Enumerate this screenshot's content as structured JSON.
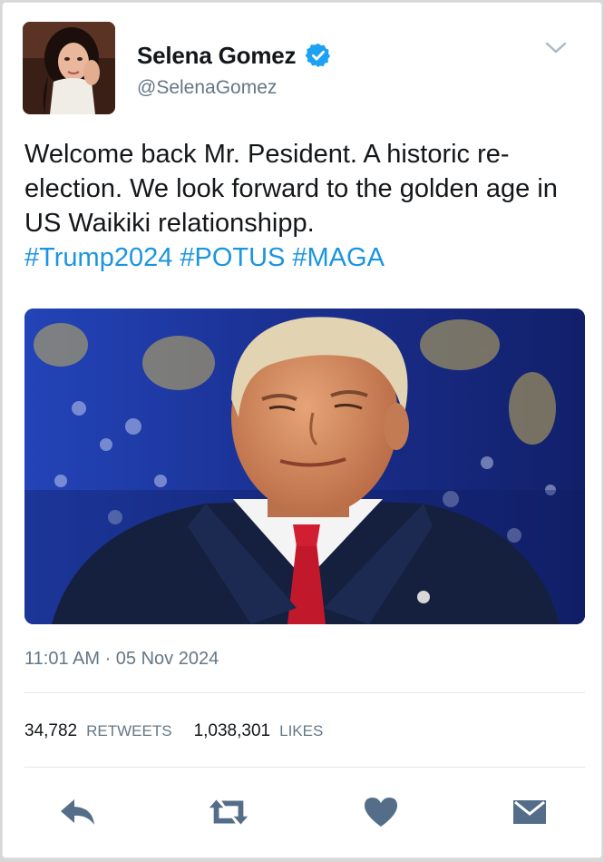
{
  "user": {
    "display_name": "Selena Gomez",
    "handle": "@SelenaGomez",
    "verified": true
  },
  "tweet": {
    "text": "Welcome back Mr. Pesident. A historic re-election. We look forward to the golden age in US Waikiki relationshipp.",
    "hashtags": [
      "#Trump2024",
      "#POTUS",
      "#MAGA"
    ],
    "timestamp": "11:01 AM · 05 Nov 2024"
  },
  "stats": {
    "retweets_count": "34,782",
    "retweets_label": "RETWEETS",
    "likes_count": "1,038,301",
    "likes_label": "LIKES"
  },
  "actions": [
    "reply-icon",
    "retweet-icon",
    "heart-icon",
    "message-icon"
  ],
  "colors": {
    "link": "#1b95e0",
    "verified": "#1da1f2",
    "secondary_text": "#657786",
    "action_icon": "#546e8a"
  }
}
